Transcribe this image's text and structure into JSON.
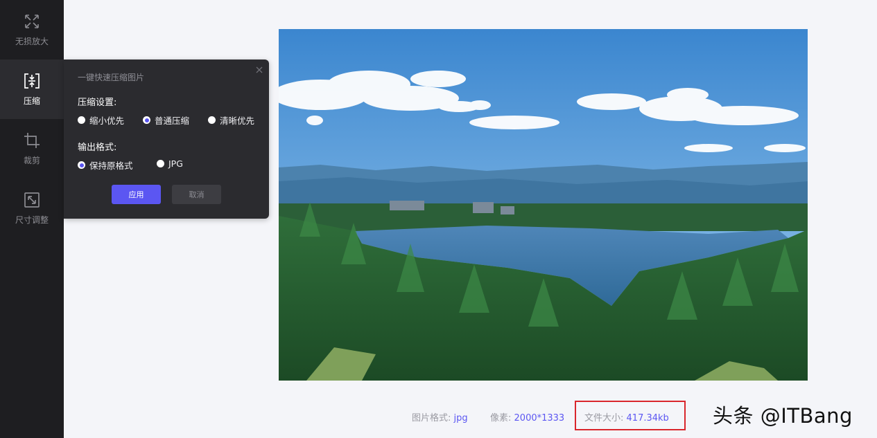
{
  "sidebar": {
    "items": [
      {
        "label": "无损放大",
        "icon": "expand-arrows-icon",
        "active": false
      },
      {
        "label": "压缩",
        "icon": "compress-icon",
        "active": true
      },
      {
        "label": "裁剪",
        "icon": "crop-icon",
        "active": false
      },
      {
        "label": "尺寸调整",
        "icon": "resize-icon",
        "active": false
      }
    ]
  },
  "panel": {
    "title": "一键快速压缩图片",
    "compress_label": "压缩设置:",
    "compress_options": [
      "缩小优先",
      "普通压缩",
      "清晰优先"
    ],
    "compress_selected": "普通压缩",
    "format_label": "输出格式:",
    "format_options": [
      "保持原格式",
      "JPG"
    ],
    "format_selected": "保持原格式",
    "apply_label": "应用",
    "cancel_label": "取消"
  },
  "image_info": {
    "format_label": "图片格式:",
    "format_value": "jpg",
    "pixels_label": "像素:",
    "pixels_value": "2000*1333",
    "size_label": "文件大小:",
    "size_value": "417.34kb"
  },
  "watermark": "头条 @ITBang",
  "colors": {
    "accent": "#5b56f2",
    "sidebar_bg": "#1e1e21",
    "panel_bg": "#2b2b2f",
    "highlight_box": "#d9262c"
  }
}
